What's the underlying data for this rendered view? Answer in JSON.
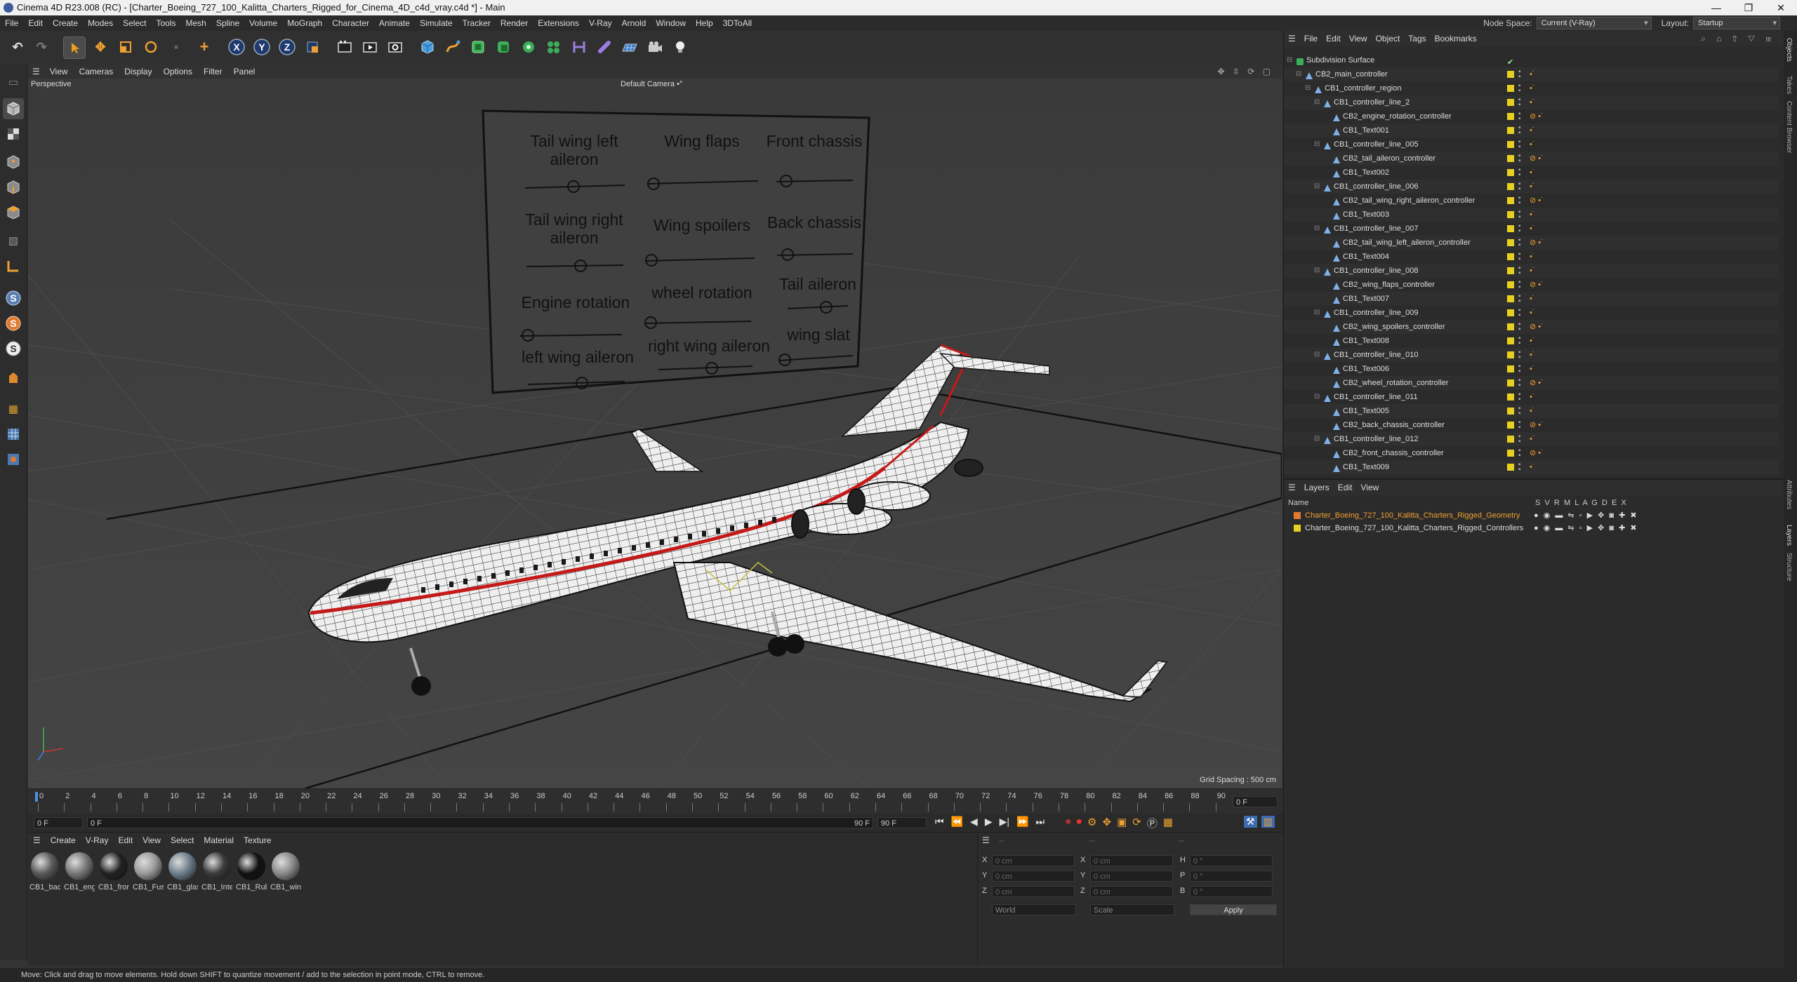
{
  "window": {
    "title": "Cinema 4D R23.008 (RC) - [Charter_Boeing_727_100_Kalitta_Charters_Rigged_for_Cinema_4D_c4d_vray.c4d *] - Main",
    "buttons": [
      "—",
      "❐",
      "✕"
    ]
  },
  "menu": [
    "File",
    "Edit",
    "Create",
    "Modes",
    "Select",
    "Tools",
    "Mesh",
    "Spline",
    "Volume",
    "MoGraph",
    "Character",
    "Animate",
    "Simulate",
    "Tracker",
    "Render",
    "Extensions",
    "V-Ray",
    "Arnold",
    "Window",
    "Help",
    "3DToAll"
  ],
  "node_space": {
    "label": "Node Space:",
    "value": "Current (V-Ray)"
  },
  "layout": {
    "label": "Layout:",
    "value": "Startup"
  },
  "viewport": {
    "menu": [
      "View",
      "Cameras",
      "Display",
      "Options",
      "Filter",
      "Panel"
    ],
    "perspective_label": "Perspective",
    "camera_label": "Default Camera •°",
    "grid_spacing": "Grid Spacing : 500 cm",
    "board": {
      "labels": [
        "Tail wing left aileron",
        "Wing flaps",
        "Front chassis",
        "Tail wing right aileron",
        "Wing spoilers",
        "Back chassis",
        "Engine rotation",
        "wheel rotation",
        "Tail aileron",
        "left wing aileron",
        "right wing aileron",
        "wing slat"
      ]
    }
  },
  "timeline": {
    "ticks": [
      "0",
      "2",
      "4",
      "6",
      "8",
      "10",
      "12",
      "14",
      "16",
      "18",
      "20",
      "22",
      "24",
      "26",
      "28",
      "30",
      "32",
      "34",
      "36",
      "38",
      "40",
      "42",
      "44",
      "46",
      "48",
      "50",
      "52",
      "54",
      "56",
      "58",
      "60",
      "62",
      "64",
      "66",
      "68",
      "70",
      "72",
      "74",
      "76",
      "78",
      "80",
      "82",
      "84",
      "86",
      "88",
      "90"
    ],
    "current_frame": "0 F",
    "start": "0 F",
    "range_start": "0 F",
    "range_end": "90 F",
    "end": "90 F"
  },
  "materials": {
    "menu": [
      "Create",
      "V-Ray",
      "Edit",
      "View",
      "Select",
      "Material",
      "Texture"
    ],
    "items": [
      {
        "label": "CB1_bac",
        "color": "#5a5a5a"
      },
      {
        "label": "CB1_eng",
        "color": "#777777"
      },
      {
        "label": "CB1_fror",
        "color": "#222222"
      },
      {
        "label": "CB1_Fus",
        "color": "#9a9a9a"
      },
      {
        "label": "CB1_glas",
        "color": "#6e7f8c"
      },
      {
        "label": "CB1_Inte",
        "color": "#3a3a3a"
      },
      {
        "label": "CB1_Rub",
        "color": "#111111"
      },
      {
        "label": "CB1_win",
        "color": "#8a8a8a"
      }
    ]
  },
  "attributes": {
    "coords": [
      {
        "axis": "X",
        "pos": "0 cm",
        "axis2": "X",
        "size": "0 cm",
        "axis3": "H",
        "rot": "0 °"
      },
      {
        "axis": "Y",
        "pos": "0 cm",
        "axis2": "Y",
        "size": "0 cm",
        "axis3": "P",
        "rot": "0 °"
      },
      {
        "axis": "Z",
        "pos": "0 cm",
        "axis2": "Z",
        "size": "0 cm",
        "axis3": "B",
        "rot": "0 °"
      }
    ],
    "world": "World",
    "scale": "Scale",
    "apply": "Apply"
  },
  "objects": {
    "menu": [
      "File",
      "Edit",
      "View",
      "Object",
      "Tags",
      "Bookmarks"
    ],
    "rows": [
      {
        "name": "Subdivision Surface",
        "level": 0,
        "tag": ""
      },
      {
        "name": "CB2_main_controller",
        "level": 1,
        "tag": "•˙"
      },
      {
        "name": "CB1_controller_region",
        "level": 2,
        "tag": "•˙"
      },
      {
        "name": "CB1_controller_line_2",
        "level": 3,
        "tag": "•˙"
      },
      {
        "name": "CB2_engine_rotation_controller",
        "level": 4,
        "tag": "⊘ •˙"
      },
      {
        "name": "CB1_Text001",
        "level": 4,
        "tag": "•˙"
      },
      {
        "name": "CB1_controller_line_005",
        "level": 3,
        "tag": "•˙"
      },
      {
        "name": "CB2_tail_aileron_controller",
        "level": 4,
        "tag": "⊘ •˙"
      },
      {
        "name": "CB1_Text002",
        "level": 4,
        "tag": "•˙"
      },
      {
        "name": "CB1_controller_line_006",
        "level": 3,
        "tag": "•˙"
      },
      {
        "name": "CB2_tail_wing_right_aileron_controller",
        "level": 4,
        "tag": "⊘ •˙"
      },
      {
        "name": "CB1_Text003",
        "level": 4,
        "tag": "•˙"
      },
      {
        "name": "CB1_controller_line_007",
        "level": 3,
        "tag": "•˙"
      },
      {
        "name": "CB2_tail_wing_left_aileron_controller",
        "level": 4,
        "tag": "⊘ •˙"
      },
      {
        "name": "CB1_Text004",
        "level": 4,
        "tag": "•˙"
      },
      {
        "name": "CB1_controller_line_008",
        "level": 3,
        "tag": "•˙"
      },
      {
        "name": "CB2_wing_flaps_controller",
        "level": 4,
        "tag": "⊘ •˙"
      },
      {
        "name": "CB1_Text007",
        "level": 4,
        "tag": "•˙"
      },
      {
        "name": "CB1_controller_line_009",
        "level": 3,
        "tag": "•˙"
      },
      {
        "name": "CB2_wing_spoilers_controller",
        "level": 4,
        "tag": "⊘ •˙"
      },
      {
        "name": "CB1_Text008",
        "level": 4,
        "tag": "•˙"
      },
      {
        "name": "CB1_controller_line_010",
        "level": 3,
        "tag": "•˙"
      },
      {
        "name": "CB1_Text006",
        "level": 4,
        "tag": "•˙"
      },
      {
        "name": "CB2_wheel_rotation_controller",
        "level": 4,
        "tag": "⊘ •˙"
      },
      {
        "name": "CB1_controller_line_011",
        "level": 3,
        "tag": "•˙"
      },
      {
        "name": "CB1_Text005",
        "level": 4,
        "tag": "•˙"
      },
      {
        "name": "CB2_back_chassis_controller",
        "level": 4,
        "tag": "⊘ •˙"
      },
      {
        "name": "CB1_controller_line_012",
        "level": 3,
        "tag": "•˙"
      },
      {
        "name": "CB2_front_chassis_controller",
        "level": 4,
        "tag": "⊘ •˙"
      },
      {
        "name": "CB1_Text009",
        "level": 4,
        "tag": "•˙"
      }
    ]
  },
  "layers": {
    "menu": [
      "Layers",
      "Edit",
      "View"
    ],
    "header_name": "Name",
    "header_cols": "S  V  R  M  L  A  G  D  E  X",
    "items": [
      {
        "name": "Charter_Boeing_727_100_Kalitta_Charters_Rigged_Geometry",
        "color": "#e07a30",
        "text_color": "#f0a030"
      },
      {
        "name": "Charter_Boeing_727_100_Kalitta_Charters_Rigged_Controllers",
        "color": "#e8d020",
        "text_color": "#dddddd"
      }
    ]
  },
  "side_tabs": [
    "Objects",
    "Takes",
    "Content Browser",
    "Attributes",
    "Layers",
    "Structure"
  ],
  "status": "Move: Click and drag to move elements. Hold down SHIFT to quantize movement / add to the selection in point mode, CTRL to remove."
}
